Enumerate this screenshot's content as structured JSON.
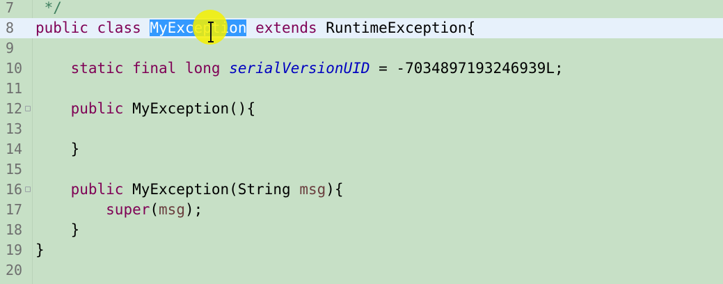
{
  "editor": {
    "lines": [
      {
        "num": "7",
        "parts": [
          {
            "t": " */",
            "c": "cm"
          }
        ]
      },
      {
        "num": "8",
        "current": true,
        "parts": [
          {
            "t": "public",
            "c": "kw"
          },
          {
            "t": " "
          },
          {
            "t": "class",
            "c": "kw"
          },
          {
            "t": " "
          },
          {
            "t": "MyException",
            "c": "sel"
          },
          {
            "t": " "
          },
          {
            "t": "extends",
            "c": "kw"
          },
          {
            "t": " RuntimeException{"
          }
        ]
      },
      {
        "num": "9",
        "parts": []
      },
      {
        "num": "10",
        "parts": [
          {
            "t": "    "
          },
          {
            "t": "static",
            "c": "kw"
          },
          {
            "t": " "
          },
          {
            "t": "final",
            "c": "kw"
          },
          {
            "t": " "
          },
          {
            "t": "long",
            "c": "kw"
          },
          {
            "t": " "
          },
          {
            "t": "serialVersionUID",
            "c": "ital"
          },
          {
            "t": " = -7034897193246939L;"
          }
        ]
      },
      {
        "num": "11",
        "parts": []
      },
      {
        "num": "12",
        "fold": true,
        "parts": [
          {
            "t": "    "
          },
          {
            "t": "public",
            "c": "kw"
          },
          {
            "t": " MyException(){"
          }
        ]
      },
      {
        "num": "13",
        "parts": []
      },
      {
        "num": "14",
        "parts": [
          {
            "t": "    }"
          }
        ]
      },
      {
        "num": "15",
        "parts": []
      },
      {
        "num": "16",
        "fold": true,
        "parts": [
          {
            "t": "    "
          },
          {
            "t": "public",
            "c": "kw"
          },
          {
            "t": " MyException(String "
          },
          {
            "t": "msg",
            "c": "var"
          },
          {
            "t": "){"
          }
        ]
      },
      {
        "num": "17",
        "parts": [
          {
            "t": "        "
          },
          {
            "t": "super",
            "c": "kw"
          },
          {
            "t": "("
          },
          {
            "t": "msg",
            "c": "var"
          },
          {
            "t": ");"
          }
        ]
      },
      {
        "num": "18",
        "parts": [
          {
            "t": "    }"
          }
        ]
      },
      {
        "num": "19",
        "parts": [
          {
            "t": "}"
          }
        ]
      },
      {
        "num": "20",
        "parts": []
      }
    ]
  },
  "colors": {
    "background": "#c7e0c6",
    "current_line": "#e7f1fb",
    "keyword": "#7f0055",
    "field": "#0000c0",
    "comment": "#3f7f5f",
    "variable": "#6a3e3e",
    "selection": "#3399ff",
    "cursor_highlight": "#f5f000"
  },
  "cursor": {
    "icon": "text-ibeam-cursor"
  }
}
